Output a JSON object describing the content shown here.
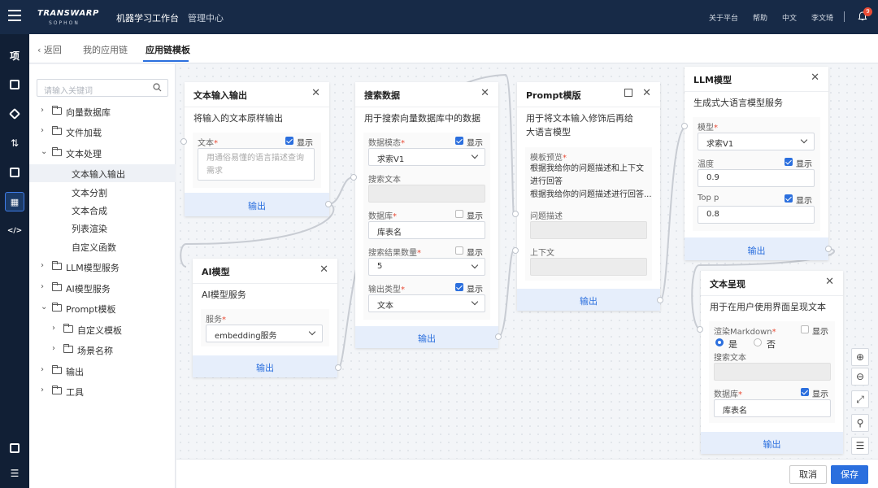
{
  "topbar": {
    "logo": "TRANSWARP",
    "logo_sub": "SOPHON",
    "nav": [
      "机器学习工作台",
      "管理中心"
    ],
    "right": [
      "关于平台",
      "帮助",
      "中文",
      "李文琦"
    ],
    "notify_count": "9"
  },
  "rail": {
    "project_label": "项"
  },
  "breadcrumb": {
    "back": "返回",
    "items": [
      "我的应用链",
      "应用链模板"
    ]
  },
  "sidebar": {
    "search_placeholder": "请输入关键词",
    "tree": [
      {
        "label": "向量数据库",
        "arrow": "›"
      },
      {
        "label": "文件加载",
        "arrow": "›"
      },
      {
        "label": "文本处理",
        "arrow": "⌄"
      },
      {
        "label": "文本输入输出"
      },
      {
        "label": "文本分割"
      },
      {
        "label": "文本合成"
      },
      {
        "label": "列表渲染"
      },
      {
        "label": "自定义函数"
      },
      {
        "label": "LLM模型服务",
        "arrow": "›"
      },
      {
        "label": "AI模型服务",
        "arrow": "›"
      },
      {
        "label": "Prompt模板",
        "arrow": "⌄"
      },
      {
        "label": "自定义模板",
        "arrow": "›"
      },
      {
        "label": "场景名称",
        "arrow": "›"
      },
      {
        "label": "输出",
        "arrow": "›"
      },
      {
        "label": "工具",
        "arrow": "›"
      }
    ]
  },
  "common": {
    "show": "显示",
    "output": "输出",
    "required": "*"
  },
  "nodes": {
    "text_io": {
      "title": "文本输入输出",
      "desc": "将输入的文本原样输出",
      "field_label": "文本",
      "placeholder_lines": [
        "用通俗易懂的语言描述查询",
        "需求"
      ]
    },
    "search": {
      "title": "搜索数据",
      "desc": "用于搜索向量数据库中的数据",
      "mode_label": "数据模态",
      "mode_value": "求索V1",
      "text_label": "搜索文本",
      "db_label": "数据库",
      "db_value": "库表名",
      "count_label": "搜索结果数量",
      "count_value": "5",
      "out_type_label": "输出类型",
      "out_type_value": "文本"
    },
    "ai_model": {
      "title": "AI模型",
      "desc": "AI模型服务",
      "service_label": "服务",
      "service_value": "embedding服务"
    },
    "prompt": {
      "title": "Prompt模版",
      "desc_lines": [
        "用于将文本输入修饰后再给",
        "大语言模型"
      ],
      "preview_label": "模板预览",
      "preview_lines": [
        "根据我给你的问题描述和上下文",
        "进行回答",
        "根据我给你的问题描述进行回答..."
      ],
      "question_label": "问题描述",
      "context_label": "上下文"
    },
    "llm": {
      "title": "LLM模型",
      "desc": "生成式大语言模型服务",
      "model_label": "模型",
      "model_value": "求索V1",
      "temp_label": "温度",
      "temp_value": "0.9",
      "topp_label": "Top p",
      "topp_value": "0.8"
    },
    "render": {
      "title": "文本呈现",
      "desc": "用于在用户使用界面呈现文本",
      "md_label": "渲染Markdown",
      "yes": "是",
      "no": "否",
      "text_label": "搜索文本",
      "db_label": "数据库",
      "db_value": "库表名"
    }
  },
  "tools": [
    "⊕",
    "⊖",
    "⤢",
    "⚲",
    "☰"
  ],
  "footer": {
    "cancel": "取消",
    "save": "保存"
  },
  "colors": {
    "accent": "#2b6fde",
    "topbar": "#172a47",
    "rail": "#111f35"
  }
}
